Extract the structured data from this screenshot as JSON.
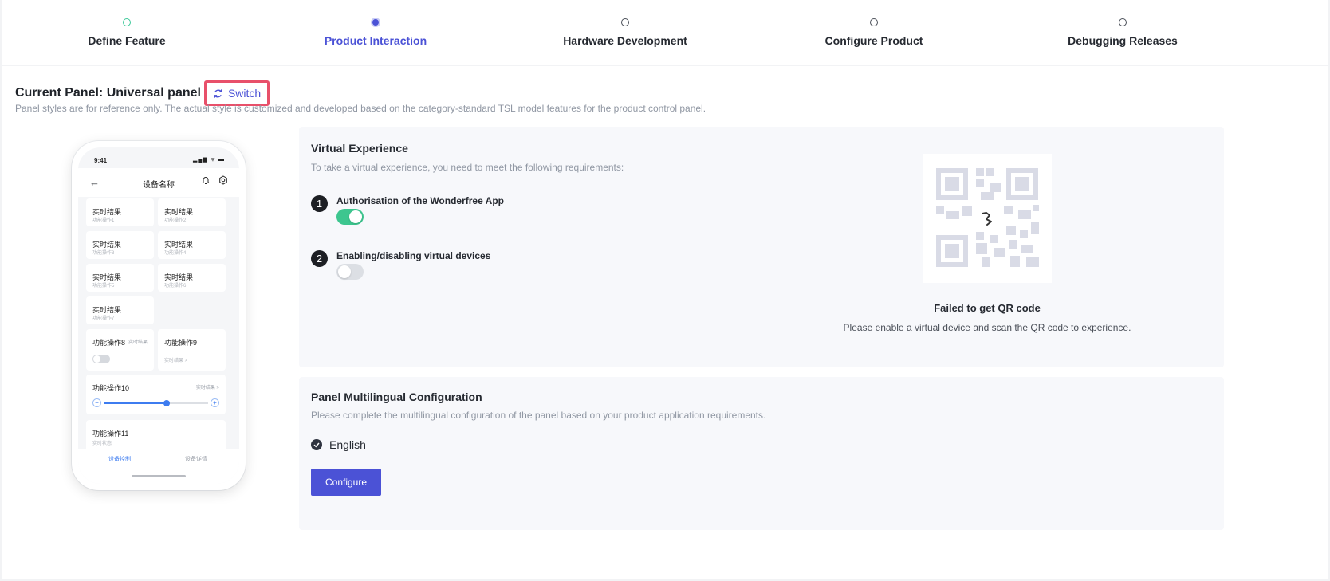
{
  "steps": [
    {
      "label": "Define Feature",
      "state": "done"
    },
    {
      "label": "Product Interaction",
      "state": "active"
    },
    {
      "label": "Hardware Development",
      "state": "pending"
    },
    {
      "label": "Configure Product",
      "state": "pending"
    },
    {
      "label": "Debugging Releases",
      "state": "pending"
    }
  ],
  "header": {
    "title": "Current Panel: Universal panel",
    "switch_label": "Switch",
    "subtitle": "Panel styles are for reference only. The actual style is customized and developed based on the category-standard TSL model features for the product control panel."
  },
  "phone": {
    "time": "9:41",
    "status_icons": "▂▄▆ ᯤ ▬",
    "device_name": "设备名称",
    "cards": [
      {
        "title": "实时结果",
        "sub": "功能操作1"
      },
      {
        "title": "实时结果",
        "sub": "功能操作2"
      },
      {
        "title": "实时结果",
        "sub": "功能操作3"
      },
      {
        "title": "实时结果",
        "sub": "功能操作4"
      },
      {
        "title": "实时结果",
        "sub": "功能操作5"
      },
      {
        "title": "实时结果",
        "sub": "功能操作6"
      },
      {
        "title": "实时结果",
        "sub": "功能操作7"
      }
    ],
    "op8": {
      "title": "功能操作8",
      "right": "实时结果"
    },
    "op9": {
      "title": "功能操作9",
      "sub": "实时结果 >"
    },
    "op10": {
      "title": "功能操作10",
      "right": "实时结果 >",
      "slider_value": 0.6
    },
    "op11": {
      "title": "功能操作11",
      "sub": "实时状态"
    },
    "tabs": [
      "设备控制",
      "设备详情"
    ]
  },
  "virtual": {
    "title": "Virtual Experience",
    "desc": "To take a virtual experience, you need to meet the following requirements:",
    "requirements": [
      {
        "num": "1",
        "label": "Authorisation of the Wonderfree App",
        "enabled": true
      },
      {
        "num": "2",
        "label": "Enabling/disabling virtual devices",
        "enabled": false
      }
    ],
    "qr_title": "Failed to get QR code",
    "qr_desc": "Please enable a virtual device and scan the QR code to experience."
  },
  "multilingual": {
    "title": "Panel Multilingual Configuration",
    "desc": "Please complete the multilingual configuration of the panel based on your product application requirements.",
    "languages": [
      {
        "label": "English",
        "checked": true
      }
    ],
    "configure_label": "Configure"
  },
  "colors": {
    "accent": "#4b52d6",
    "success": "#3dc68f",
    "highlight": "#e8506a"
  }
}
